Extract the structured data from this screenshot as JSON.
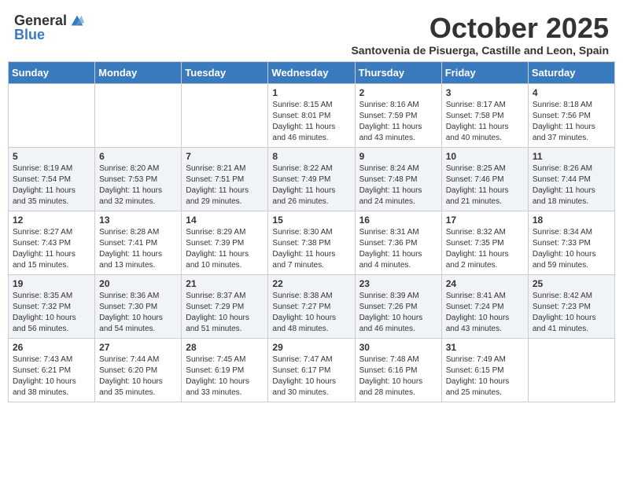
{
  "header": {
    "logo_general": "General",
    "logo_blue": "Blue",
    "month_title": "October 2025",
    "subtitle": "Santovenia de Pisuerga, Castille and Leon, Spain"
  },
  "days_of_week": [
    "Sunday",
    "Monday",
    "Tuesday",
    "Wednesday",
    "Thursday",
    "Friday",
    "Saturday"
  ],
  "weeks": [
    [
      {
        "day": "",
        "info": ""
      },
      {
        "day": "",
        "info": ""
      },
      {
        "day": "",
        "info": ""
      },
      {
        "day": "1",
        "info": "Sunrise: 8:15 AM\nSunset: 8:01 PM\nDaylight: 11 hours and 46 minutes."
      },
      {
        "day": "2",
        "info": "Sunrise: 8:16 AM\nSunset: 7:59 PM\nDaylight: 11 hours and 43 minutes."
      },
      {
        "day": "3",
        "info": "Sunrise: 8:17 AM\nSunset: 7:58 PM\nDaylight: 11 hours and 40 minutes."
      },
      {
        "day": "4",
        "info": "Sunrise: 8:18 AM\nSunset: 7:56 PM\nDaylight: 11 hours and 37 minutes."
      }
    ],
    [
      {
        "day": "5",
        "info": "Sunrise: 8:19 AM\nSunset: 7:54 PM\nDaylight: 11 hours and 35 minutes."
      },
      {
        "day": "6",
        "info": "Sunrise: 8:20 AM\nSunset: 7:53 PM\nDaylight: 11 hours and 32 minutes."
      },
      {
        "day": "7",
        "info": "Sunrise: 8:21 AM\nSunset: 7:51 PM\nDaylight: 11 hours and 29 minutes."
      },
      {
        "day": "8",
        "info": "Sunrise: 8:22 AM\nSunset: 7:49 PM\nDaylight: 11 hours and 26 minutes."
      },
      {
        "day": "9",
        "info": "Sunrise: 8:24 AM\nSunset: 7:48 PM\nDaylight: 11 hours and 24 minutes."
      },
      {
        "day": "10",
        "info": "Sunrise: 8:25 AM\nSunset: 7:46 PM\nDaylight: 11 hours and 21 minutes."
      },
      {
        "day": "11",
        "info": "Sunrise: 8:26 AM\nSunset: 7:44 PM\nDaylight: 11 hours and 18 minutes."
      }
    ],
    [
      {
        "day": "12",
        "info": "Sunrise: 8:27 AM\nSunset: 7:43 PM\nDaylight: 11 hours and 15 minutes."
      },
      {
        "day": "13",
        "info": "Sunrise: 8:28 AM\nSunset: 7:41 PM\nDaylight: 11 hours and 13 minutes."
      },
      {
        "day": "14",
        "info": "Sunrise: 8:29 AM\nSunset: 7:39 PM\nDaylight: 11 hours and 10 minutes."
      },
      {
        "day": "15",
        "info": "Sunrise: 8:30 AM\nSunset: 7:38 PM\nDaylight: 11 hours and 7 minutes."
      },
      {
        "day": "16",
        "info": "Sunrise: 8:31 AM\nSunset: 7:36 PM\nDaylight: 11 hours and 4 minutes."
      },
      {
        "day": "17",
        "info": "Sunrise: 8:32 AM\nSunset: 7:35 PM\nDaylight: 11 hours and 2 minutes."
      },
      {
        "day": "18",
        "info": "Sunrise: 8:34 AM\nSunset: 7:33 PM\nDaylight: 10 hours and 59 minutes."
      }
    ],
    [
      {
        "day": "19",
        "info": "Sunrise: 8:35 AM\nSunset: 7:32 PM\nDaylight: 10 hours and 56 minutes."
      },
      {
        "day": "20",
        "info": "Sunrise: 8:36 AM\nSunset: 7:30 PM\nDaylight: 10 hours and 54 minutes."
      },
      {
        "day": "21",
        "info": "Sunrise: 8:37 AM\nSunset: 7:29 PM\nDaylight: 10 hours and 51 minutes."
      },
      {
        "day": "22",
        "info": "Sunrise: 8:38 AM\nSunset: 7:27 PM\nDaylight: 10 hours and 48 minutes."
      },
      {
        "day": "23",
        "info": "Sunrise: 8:39 AM\nSunset: 7:26 PM\nDaylight: 10 hours and 46 minutes."
      },
      {
        "day": "24",
        "info": "Sunrise: 8:41 AM\nSunset: 7:24 PM\nDaylight: 10 hours and 43 minutes."
      },
      {
        "day": "25",
        "info": "Sunrise: 8:42 AM\nSunset: 7:23 PM\nDaylight: 10 hours and 41 minutes."
      }
    ],
    [
      {
        "day": "26",
        "info": "Sunrise: 7:43 AM\nSunset: 6:21 PM\nDaylight: 10 hours and 38 minutes."
      },
      {
        "day": "27",
        "info": "Sunrise: 7:44 AM\nSunset: 6:20 PM\nDaylight: 10 hours and 35 minutes."
      },
      {
        "day": "28",
        "info": "Sunrise: 7:45 AM\nSunset: 6:19 PM\nDaylight: 10 hours and 33 minutes."
      },
      {
        "day": "29",
        "info": "Sunrise: 7:47 AM\nSunset: 6:17 PM\nDaylight: 10 hours and 30 minutes."
      },
      {
        "day": "30",
        "info": "Sunrise: 7:48 AM\nSunset: 6:16 PM\nDaylight: 10 hours and 28 minutes."
      },
      {
        "day": "31",
        "info": "Sunrise: 7:49 AM\nSunset: 6:15 PM\nDaylight: 10 hours and 25 minutes."
      },
      {
        "day": "",
        "info": ""
      }
    ]
  ]
}
